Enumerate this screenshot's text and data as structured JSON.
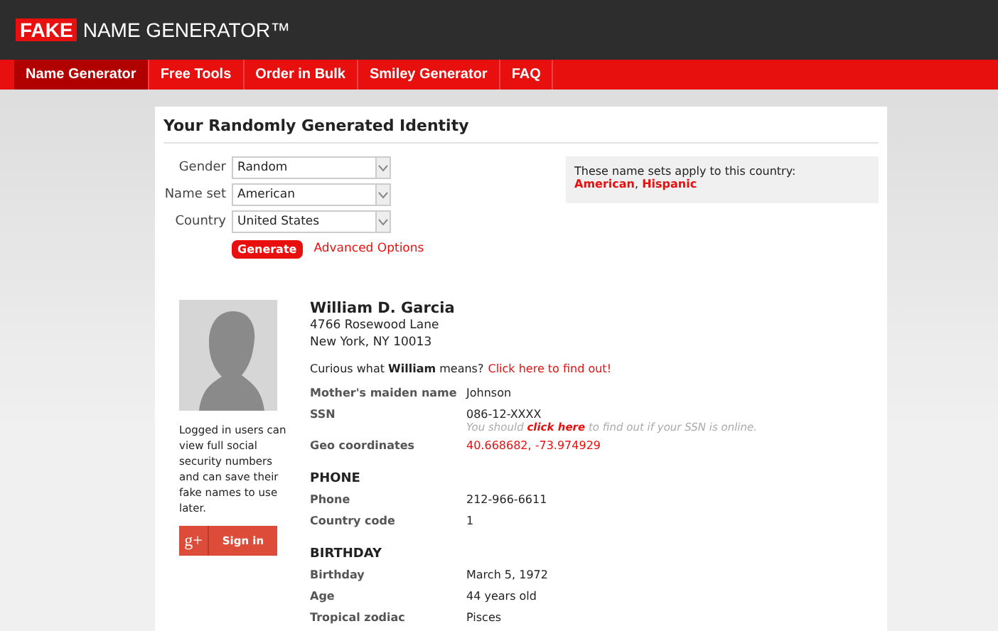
{
  "header": {
    "logo_badge": "FAKE",
    "logo_text": "NAME GENERATOR™"
  },
  "nav": [
    {
      "label": "Name Generator",
      "selected": true
    },
    {
      "label": "Free Tools",
      "selected": false
    },
    {
      "label": "Order in Bulk",
      "selected": false
    },
    {
      "label": "Smiley Generator",
      "selected": false
    },
    {
      "label": "FAQ",
      "selected": false
    }
  ],
  "card_title": "Your Randomly Generated Identity",
  "form": {
    "fields": [
      {
        "label": "Gender",
        "value": "Random"
      },
      {
        "label": "Name set",
        "value": "American"
      },
      {
        "label": "Country",
        "value": "United States"
      }
    ],
    "generate_button": "Generate",
    "advanced_link": "Advanced Options"
  },
  "info_box": {
    "text": "These name sets apply to this country:",
    "sets": "**American**, **Hispanic**"
  },
  "sidebar": {
    "login_text": "Logged in users can view full social security numbers and can save their fake names to use later.",
    "signin_icon_text": "g+",
    "signin_button": "Sign in"
  },
  "identity": {
    "name": "William D. Garcia",
    "address": [
      "4766 Rosewood Lane",
      "New York, NY 10013"
    ],
    "curious": "Curious what **William** means?",
    "curious_link": "Click here to find out!"
  },
  "sections": [
    {
      "rows": [
        {
          "label": "Mother's maiden name",
          "value": "Johnson",
          "kind": "text"
        },
        {
          "label": "SSN",
          "value": "086-12-XXXX",
          "kind": "text",
          "note": "You should **click here** to find out if your SSN is online."
        },
        {
          "label": "Geo coordinates",
          "value": "40.668682, -73.974929",
          "kind": "link"
        }
      ]
    },
    {
      "heading": "PHONE",
      "rows": [
        {
          "label": "Phone",
          "value": "212-966-6611",
          "kind": "text"
        },
        {
          "label": "Country code",
          "value": "1",
          "kind": "text"
        }
      ]
    },
    {
      "heading": "BIRTHDAY",
      "rows": [
        {
          "label": "Birthday",
          "value": "March 5, 1972",
          "kind": "text"
        },
        {
          "label": "Age",
          "value": "44 years old",
          "kind": "text"
        },
        {
          "label": "Tropical zodiac",
          "value": "Pisces",
          "kind": "text"
        }
      ]
    }
  ]
}
